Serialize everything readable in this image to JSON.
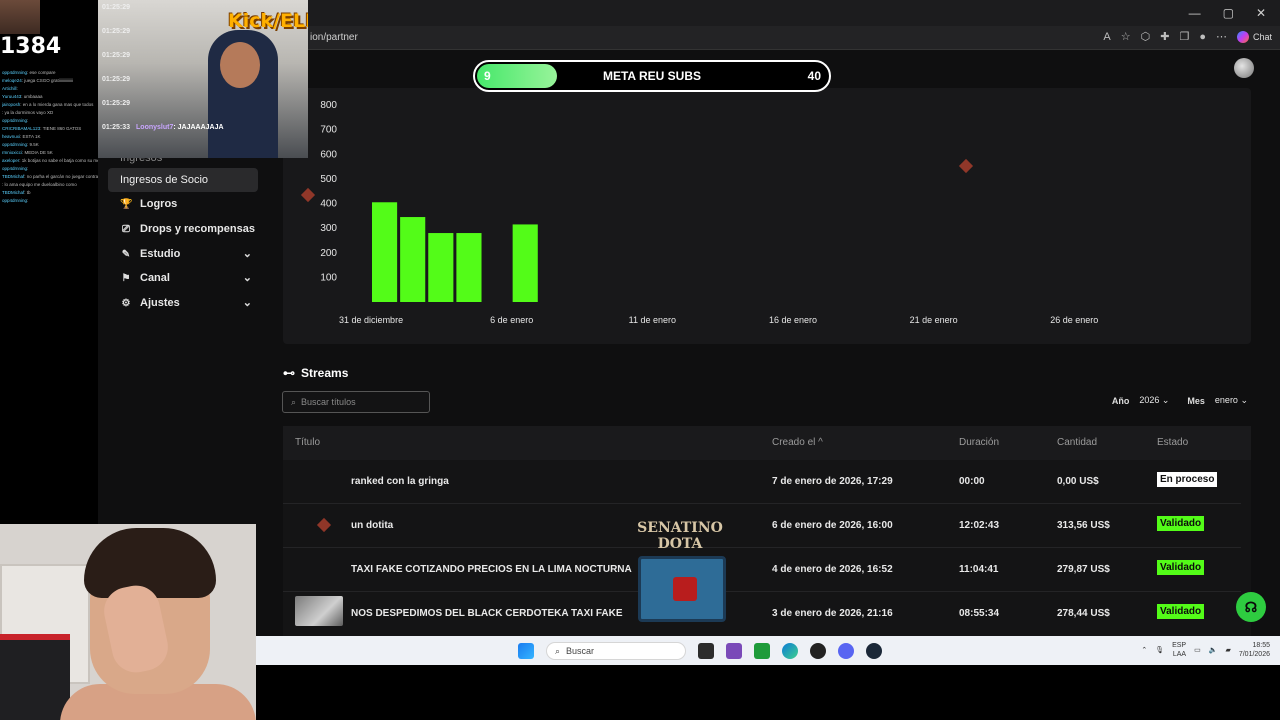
{
  "overlay": {
    "kick_label": "Kick/ELMichiJ",
    "viewer_count": "1384",
    "meta": {
      "title": "META REU SUBS",
      "current": "9",
      "goal": "40",
      "progress_fraction": 0.225
    },
    "chat_times": [
      "01:25:29",
      "01:25:29",
      "01:25:29",
      "01:25:29",
      "01:25:29",
      "01:25:33"
    ],
    "chat_last_user": "Loonyslut7",
    "chat_last_msg": "JAJAAAJAJA",
    "left_chat": [
      {
        "user": "opp4drnning",
        "msg": "ese compare"
      },
      {
        "user": "meloqe24",
        "msg": "juega CSGO gratiiiiiiiiiiiiii"
      },
      {
        "user": "Artichill",
        "msg": ""
      },
      {
        "user": "Yuruu443",
        "msg": "umbaaaa"
      },
      {
        "user": "jairoposh",
        "msg": "en a lo mierda gana mas que todos"
      },
      {
        "user": "",
        "msg": "ya la dormimos vayo XD"
      },
      {
        "user": "opp4drnning",
        "msg": ""
      },
      {
        "user": "CRICRIBAMAL123",
        "msg": "TIENE 860 GATOS"
      },
      {
        "user": "heavnuxi",
        "msg": "ESTA 1K"
      },
      {
        "user": "opp4drnning",
        "msg": "9.5K"
      },
      {
        "user": "rmnioxicci",
        "msg": "MEDIA DE 5K"
      },
      {
        "user": "axeloper",
        "msg": "1k botijas no sabe el batja como su mente"
      },
      {
        "user": "opp4drnning",
        "msg": ""
      },
      {
        "user": "TBDMichaf",
        "msg": "no parha el garcán no juegar contra XS"
      },
      {
        "user": "",
        "msg": "lo ama equipo me dueloalbino como"
      },
      {
        "user": "TBDMichaf",
        "msg": "tb"
      },
      {
        "user": "opp4drnning",
        "msg": ""
      }
    ],
    "watermark": {
      "line1": "SENATINO",
      "line2": "DOTA"
    }
  },
  "browser": {
    "url": "ion/partner",
    "chat_button": "Chat"
  },
  "sidebar": {
    "partial_item": "Ingresos",
    "items": [
      {
        "label": "Ingresos de Socio",
        "icon": "",
        "active": true,
        "expandable": false
      },
      {
        "label": "Logros",
        "icon": "trophy-icon",
        "glyph": "🏆",
        "active": false,
        "expandable": false
      },
      {
        "label": "Drops y recompensas",
        "icon": "gift-icon",
        "glyph": "⎚",
        "active": false,
        "expandable": false
      },
      {
        "label": "Estudio",
        "icon": "studio-icon",
        "glyph": "✎",
        "active": false,
        "expandable": true
      },
      {
        "label": "Canal",
        "icon": "channel-icon",
        "glyph": "⚑",
        "active": false,
        "expandable": true
      },
      {
        "label": "Ajustes",
        "icon": "gear-icon",
        "glyph": "⚙",
        "active": false,
        "expandable": true
      }
    ]
  },
  "chart_data": {
    "type": "bar",
    "y_ticks": [
      100,
      200,
      300,
      400,
      500,
      600,
      700,
      800
    ],
    "ylim": [
      0,
      800
    ],
    "x_tick_labels": [
      "31 de diciembre",
      "6 de enero",
      "11 de enero",
      "16 de enero",
      "21 de enero",
      "26 de enero"
    ],
    "x_domain_days": 31,
    "bar_color": "#53fc18",
    "series": [
      {
        "values": [
          {
            "day": 1,
            "value": 405
          },
          {
            "day": 2,
            "value": 345
          },
          {
            "day": 3,
            "value": 280
          },
          {
            "day": 4,
            "value": 280
          },
          {
            "day": 6,
            "value": 315
          }
        ]
      }
    ],
    "title": "",
    "xlabel": "",
    "ylabel": ""
  },
  "streams": {
    "title": "Streams",
    "search_placeholder": "Buscar títulos",
    "year_label": "Año",
    "year_value": "2026",
    "month_label": "Mes",
    "month_value": "enero",
    "columns": {
      "title": "Título",
      "created": "Creado el",
      "duration": "Duración",
      "amount": "Cantidad",
      "status": "Estado"
    },
    "rows": [
      {
        "title": "ranked con la gringa",
        "created": "7 de enero de 2026, 17:29",
        "duration": "00:00",
        "amount": "0,00 US$",
        "status": "En proceso",
        "status_kind": "proc"
      },
      {
        "title": "un dotita",
        "created": "6 de enero de 2026, 16:00",
        "duration": "12:02:43",
        "amount": "313,56 US$",
        "status": "Validado",
        "status_kind": "ok"
      },
      {
        "title": "TAXI FAKE COTIZANDO PRECIOS EN LA LIMA NOCTURNA",
        "created": "4 de enero de 2026, 16:52",
        "duration": "11:04:41",
        "amount": "279,87 US$",
        "status": "Validado",
        "status_kind": "ok"
      },
      {
        "title": "NOS DESPEDIMOS DEL BLACK CERDOTEKA TAXI FAKE",
        "created": "3 de enero de 2026, 21:16",
        "duration": "08:55:34",
        "amount": "278,44 US$",
        "status": "Validado",
        "status_kind": "ok"
      }
    ]
  },
  "taskbar": {
    "search_label": "Buscar",
    "lang_top": "ESP",
    "lang_bottom": "LAA",
    "time": "18:55",
    "date": "7/01/2026"
  }
}
